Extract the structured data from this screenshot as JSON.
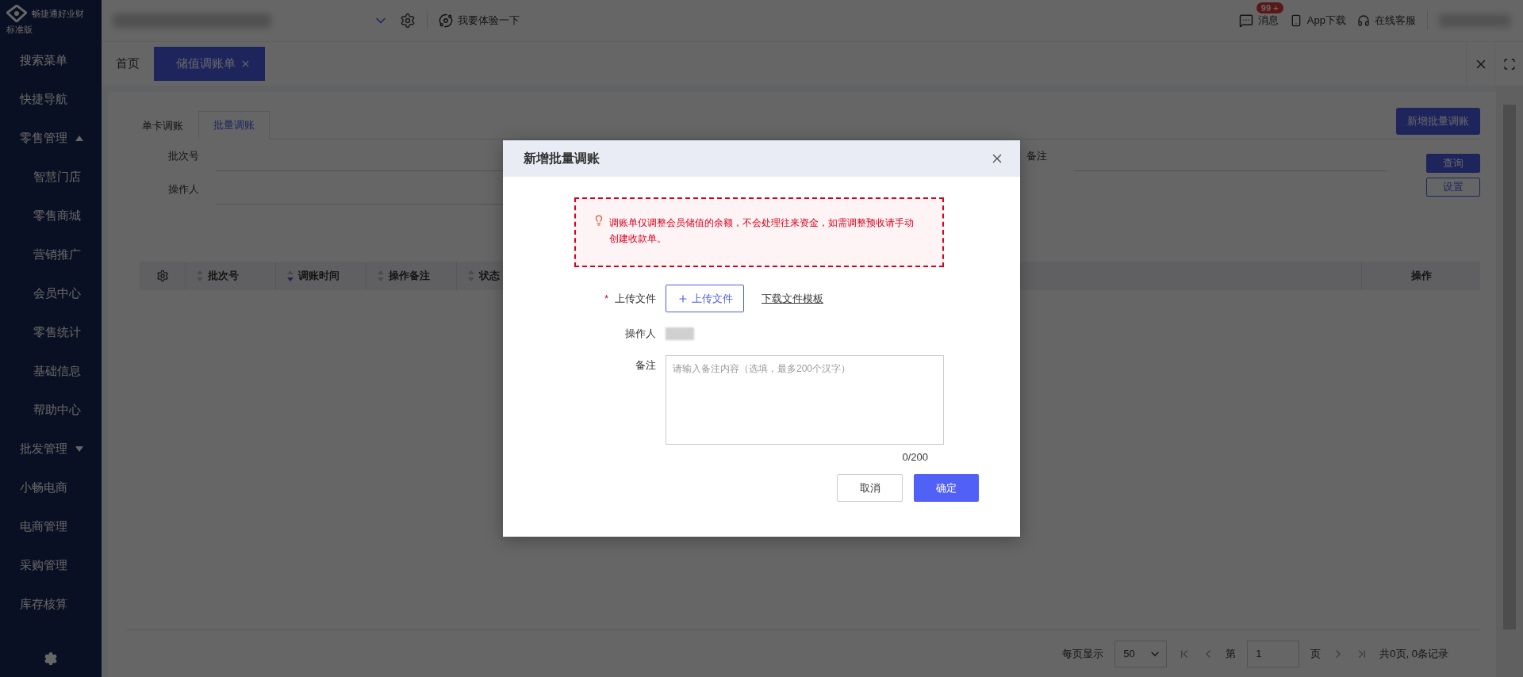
{
  "brand": {
    "name": "畅捷通好业财",
    "edition": "标准版"
  },
  "sidebar": {
    "items": [
      {
        "label": "搜索菜单"
      },
      {
        "label": "快捷导航"
      },
      {
        "label": "零售管理",
        "expanded": true,
        "children": [
          {
            "label": "智慧门店"
          },
          {
            "label": "零售商城"
          },
          {
            "label": "营销推广"
          },
          {
            "label": "会员中心"
          },
          {
            "label": "零售统计"
          },
          {
            "label": "基础信息"
          },
          {
            "label": "帮助中心"
          }
        ]
      },
      {
        "label": "批发管理",
        "expanded": false
      },
      {
        "label": "小畅电商"
      },
      {
        "label": "电商管理"
      },
      {
        "label": "采购管理"
      },
      {
        "label": "库存核算"
      }
    ]
  },
  "topbar": {
    "trial": "我要体验一下",
    "messages": {
      "label": "消息",
      "badge": "99 +"
    },
    "app_download": "App下载",
    "service": "在线客服"
  },
  "page_tabs": [
    {
      "label": "首页",
      "selected": false,
      "closable": false
    },
    {
      "label": "储值调账单",
      "selected": true,
      "closable": true
    }
  ],
  "sub_tabs": [
    {
      "label": "单卡调账",
      "selected": false
    },
    {
      "label": "批量调账",
      "selected": true
    }
  ],
  "new_button": "新增批量调账",
  "filters": {
    "batch_no": "批次号",
    "operator": "操作人",
    "remark": "备注",
    "query": "查询",
    "settings": "设置"
  },
  "table": {
    "columns": [
      {
        "label": "批次号",
        "sorted": false
      },
      {
        "label": "调账时间",
        "sorted": true
      },
      {
        "label": "操作备注",
        "sorted": false
      },
      {
        "label": "状态",
        "sorted": false
      }
    ],
    "action_column": "操作"
  },
  "pagination": {
    "per_page_label": "每页显示",
    "per_page": "50",
    "page_prefix": "第",
    "page": "1",
    "page_suffix": "页",
    "summary": "共0页, 0条记录"
  },
  "dialog": {
    "title": "新增批量调账",
    "notice": "调账单仅调整会员储值的余额，不会处理往来资金，如需调整预收请手动创建收款单。",
    "upload_label": "上传文件",
    "required_mark": "*",
    "upload_button": "上传文件",
    "template_link": "下载文件模板",
    "operator_label": "操作人",
    "remark_label": "备注",
    "remark_placeholder": "请输入备注内容（选填，最多200个汉字）",
    "counter": "0/200",
    "cancel": "取消",
    "confirm": "确定"
  }
}
